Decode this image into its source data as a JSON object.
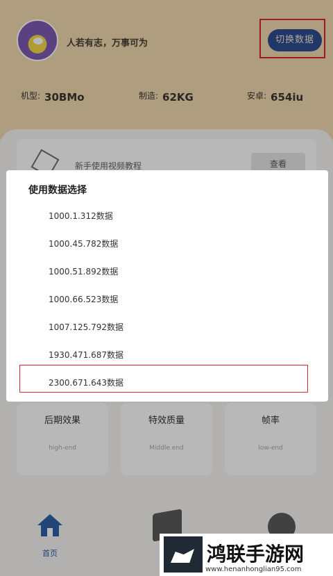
{
  "header": {
    "motto": "人若有志，万事可为",
    "switch_button": "切换数据"
  },
  "stats": [
    {
      "label": "机型:",
      "value": "30BMo"
    },
    {
      "label": "制造:",
      "value": "62KG"
    },
    {
      "label": "安卓:",
      "value": "654iu"
    }
  ],
  "tutorial": {
    "text": "新手使用视频教程",
    "button": "查看"
  },
  "dialog": {
    "title": "使用数据选择",
    "options": [
      "1000.1.312数据",
      "1000.45.782数据",
      "1000.51.892数据",
      "1000.66.523数据",
      "1007.125.792数据",
      "1930.471.687数据",
      "2300.671.643数据"
    ],
    "highlighted_index": 6
  },
  "cards": [
    {
      "title": "后期效果",
      "sub": "high-end"
    },
    {
      "title": "特效质量",
      "sub": "Middle end"
    },
    {
      "title": "帧率",
      "sub": "low-end"
    }
  ],
  "nav": {
    "home": "首页"
  },
  "watermark": {
    "title": "鸿联手游网",
    "url": "www.henanhonglian95.com"
  },
  "colors": {
    "header_bg": "#f2dcb0",
    "button_bg": "#2f4d90",
    "highlight_border": "#d9282f"
  }
}
